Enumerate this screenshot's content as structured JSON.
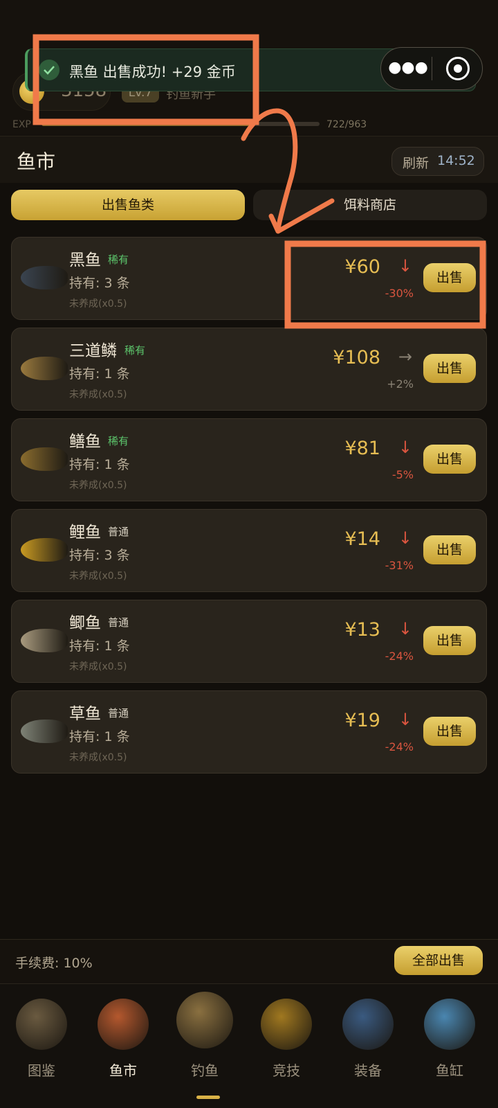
{
  "header": {
    "coins": "3158",
    "level": "Lv.7",
    "title": "钓鱼新手",
    "exp_label": "EXP",
    "exp_value": "722/963",
    "exp_fraction": 0.75
  },
  "toast": {
    "message": "黑鱼 出售成功! +29 金币"
  },
  "market": {
    "title": "鱼市",
    "refresh_label": "刷新",
    "refresh_time": "14:52"
  },
  "tabs": {
    "sell": "出售鱼类",
    "bait": "饵料商店"
  },
  "fish": [
    {
      "name": "黑鱼",
      "rarity": "稀有",
      "rare": true,
      "held": "持有: 3 条",
      "note": "未养成(x0.5)",
      "price": "¥60",
      "trend": "↓",
      "change": "-30%",
      "color": "#3a4450",
      "sell": "出售"
    },
    {
      "name": "三道鳞",
      "rarity": "稀有",
      "rare": true,
      "held": "持有: 1 条",
      "note": "未养成(x0.5)",
      "price": "¥108",
      "trend": "→",
      "change": "+2%",
      "color": "#9a7a3e",
      "sell": "出售"
    },
    {
      "name": "鳝鱼",
      "rarity": "稀有",
      "rare": true,
      "held": "持有: 1 条",
      "note": "未养成(x0.5)",
      "price": "¥81",
      "trend": "↓",
      "change": "-5%",
      "color": "#8a6c2e",
      "sell": "出售"
    },
    {
      "name": "鲤鱼",
      "rarity": "普通",
      "rare": false,
      "held": "持有: 3 条",
      "note": "未养成(x0.5)",
      "price": "¥14",
      "trend": "↓",
      "change": "-31%",
      "color": "#c99a22",
      "sell": "出售"
    },
    {
      "name": "鲫鱼",
      "rarity": "普通",
      "rare": false,
      "held": "持有: 1 条",
      "note": "未养成(x0.5)",
      "price": "¥13",
      "trend": "↓",
      "change": "-24%",
      "color": "#a89a7e",
      "sell": "出售"
    },
    {
      "name": "草鱼",
      "rarity": "普通",
      "rare": false,
      "held": "持有: 1 条",
      "note": "未养成(x0.5)",
      "price": "¥19",
      "trend": "↓",
      "change": "-24%",
      "color": "#7e8276",
      "sell": "出售"
    }
  ],
  "footer": {
    "fee": "手续费: 10%",
    "sell_all": "全部出售"
  },
  "nav": [
    {
      "label": "图鉴",
      "icon": "book-icon"
    },
    {
      "label": "鱼市",
      "icon": "market-icon"
    },
    {
      "label": "钓鱼",
      "icon": "fishing-icon"
    },
    {
      "label": "竞技",
      "icon": "trophy-icon"
    },
    {
      "label": "装备",
      "icon": "reel-icon"
    },
    {
      "label": "鱼缸",
      "icon": "fishbowl-icon"
    }
  ],
  "colors": {
    "accent": "#d9b247",
    "down": "#d9553f",
    "rare": "#5cc46b",
    "annotation": "#f07a4a"
  }
}
